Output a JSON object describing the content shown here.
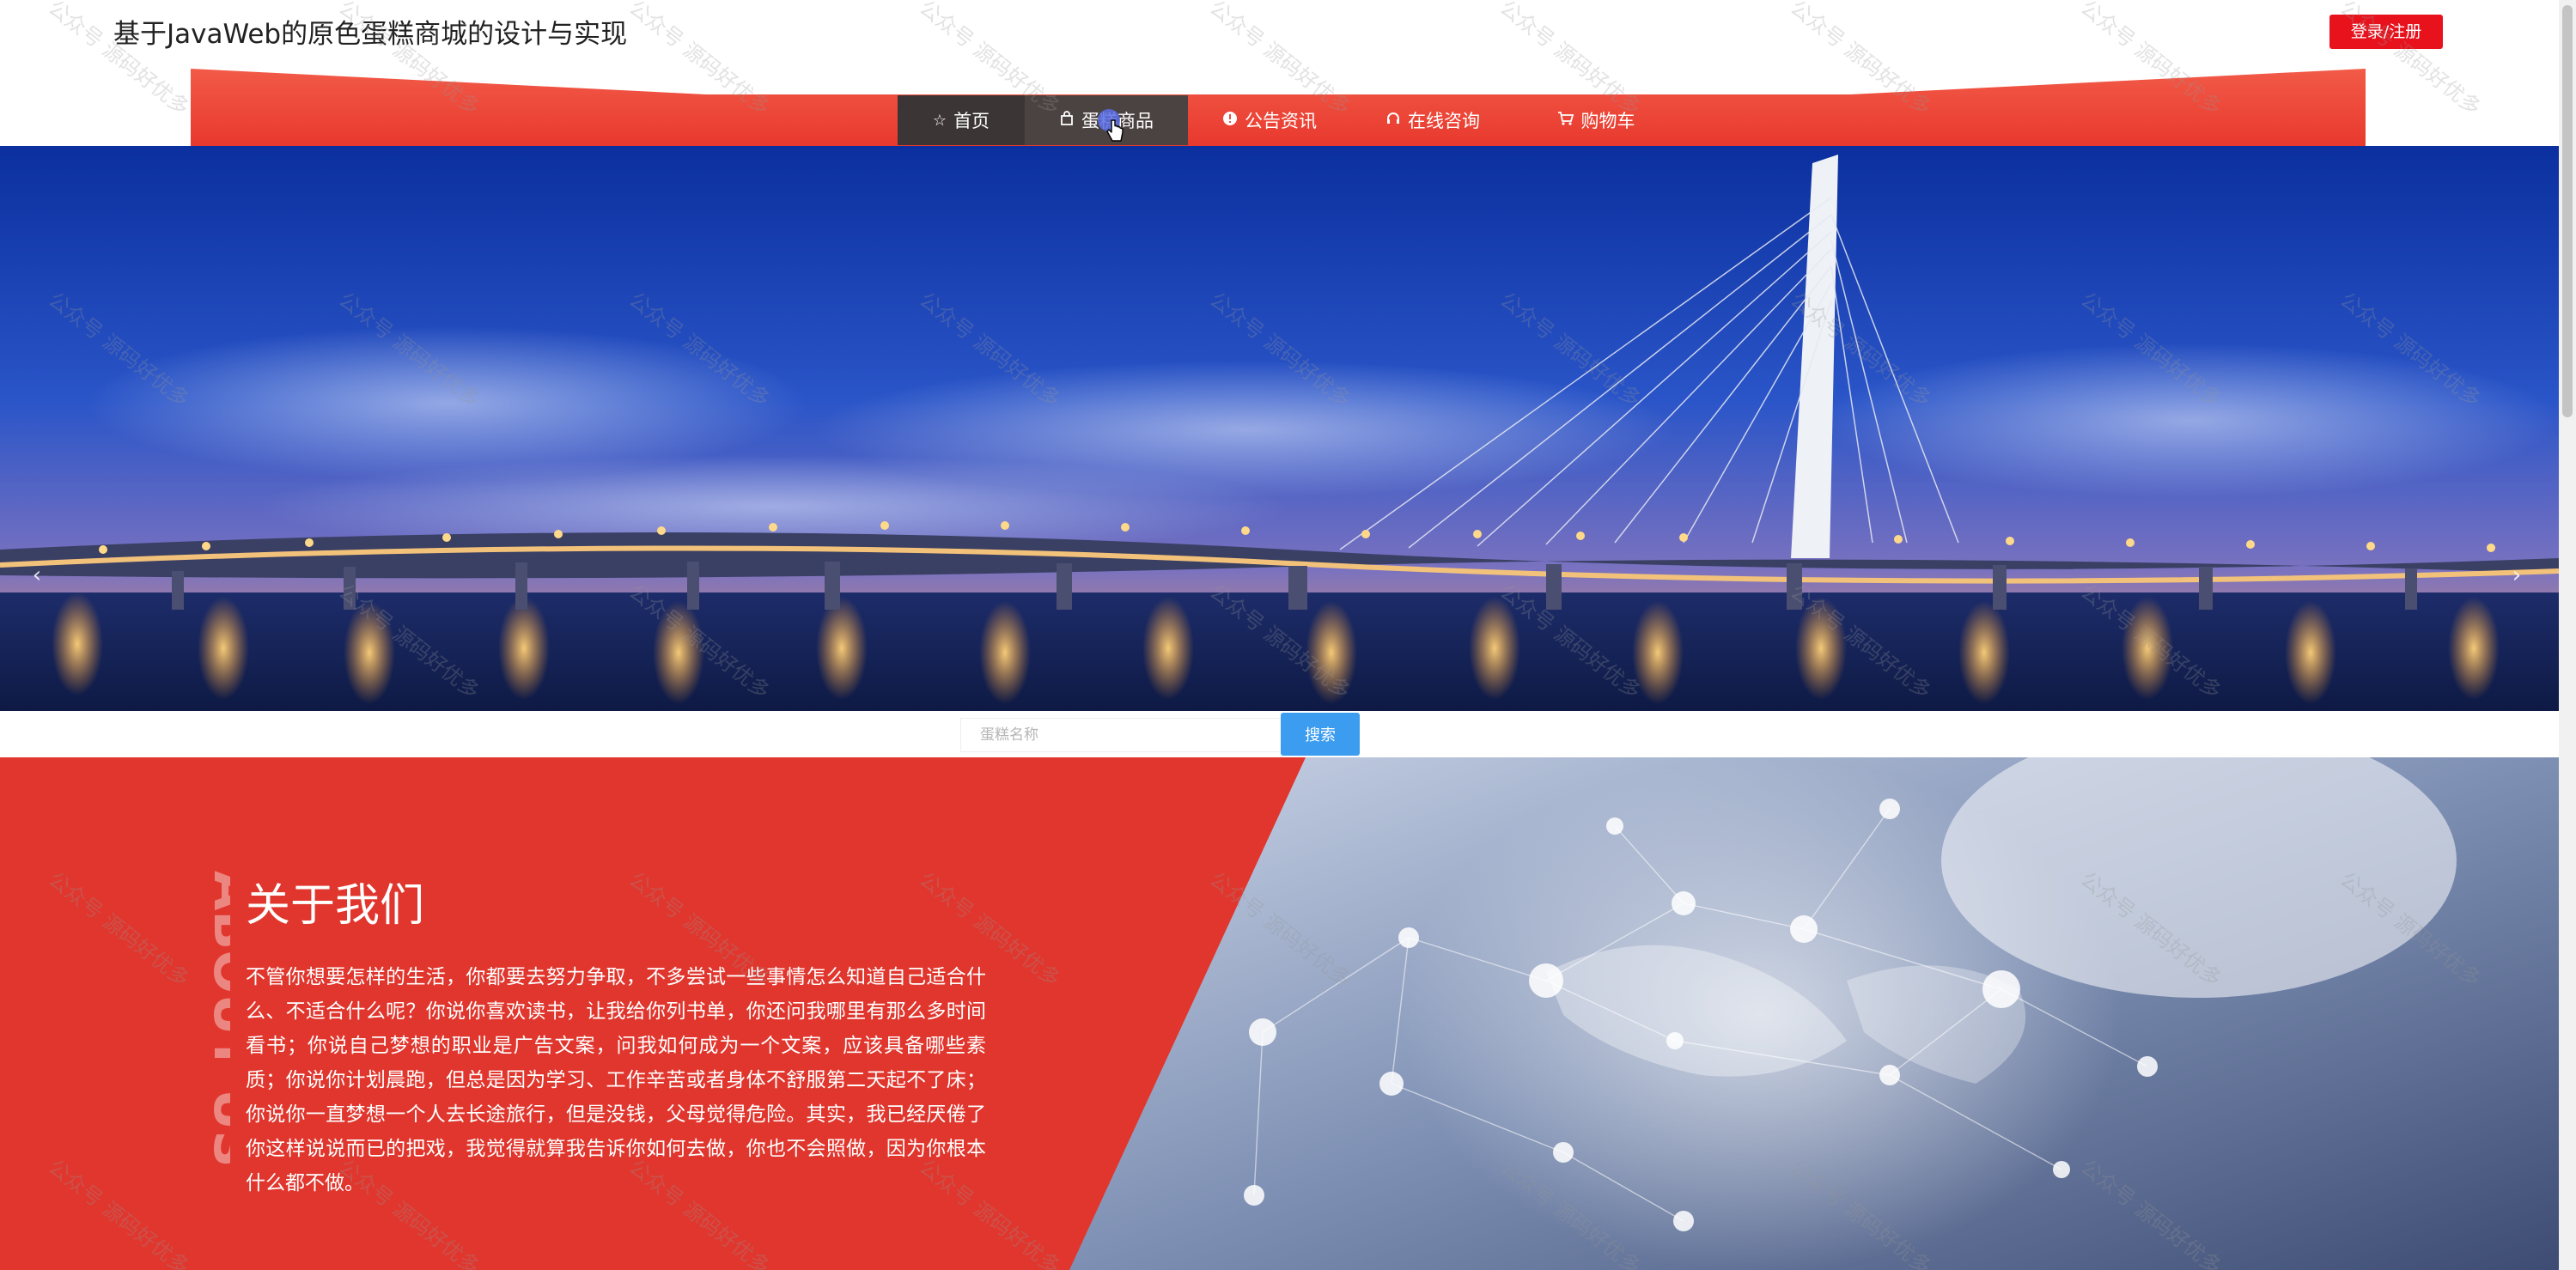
{
  "header": {
    "site_title": "基于JavaWeb的原色蛋糕商城的设计与实现",
    "login_label": "登录/注册"
  },
  "nav": {
    "items": [
      {
        "label": "首页",
        "icon": "star-icon"
      },
      {
        "label": "蛋糕商品",
        "icon": "bag-icon"
      },
      {
        "label": "公告资讯",
        "icon": "info-icon"
      },
      {
        "label": "在线咨询",
        "icon": "headset-icon"
      },
      {
        "label": "购物车",
        "icon": "cart-icon"
      }
    ]
  },
  "carousel": {
    "prev_label": "‹",
    "next_label": "›"
  },
  "search": {
    "placeholder": "蛋糕名称",
    "button_label": "搜索"
  },
  "about": {
    "vertical_label": "ABOUT US",
    "title": "关于我们",
    "paragraph": "不管你想要怎样的生活，你都要去努力争取，不多尝试一些事情怎么知道自己适合什么、不适合什么呢？你说你喜欢读书，让我给你列书单，你还问我哪里有那么多时间看书；你说自己梦想的职业是广告文案，问我如何成为一个文案，应该具备哪些素质；你说你计划晨跑，但总是因为学习、工作辛苦或者身体不舒服第二天起不了床；你说你一直梦想一个人去长途旅行，但是没钱，父母觉得危险。其实，我已经厌倦了你这样说说而已的把戏，我觉得就算我告诉你如何去做，你也不会照做，因为你根本什么都不做。"
  },
  "watermark": {
    "text": "公众号 源码好优多"
  },
  "colors": {
    "accent_red": "#e0362d",
    "nav_red": "#f0463a",
    "login_red": "#e8121d",
    "search_blue": "#3b9cf0",
    "nav_dark": "#3b3635"
  }
}
